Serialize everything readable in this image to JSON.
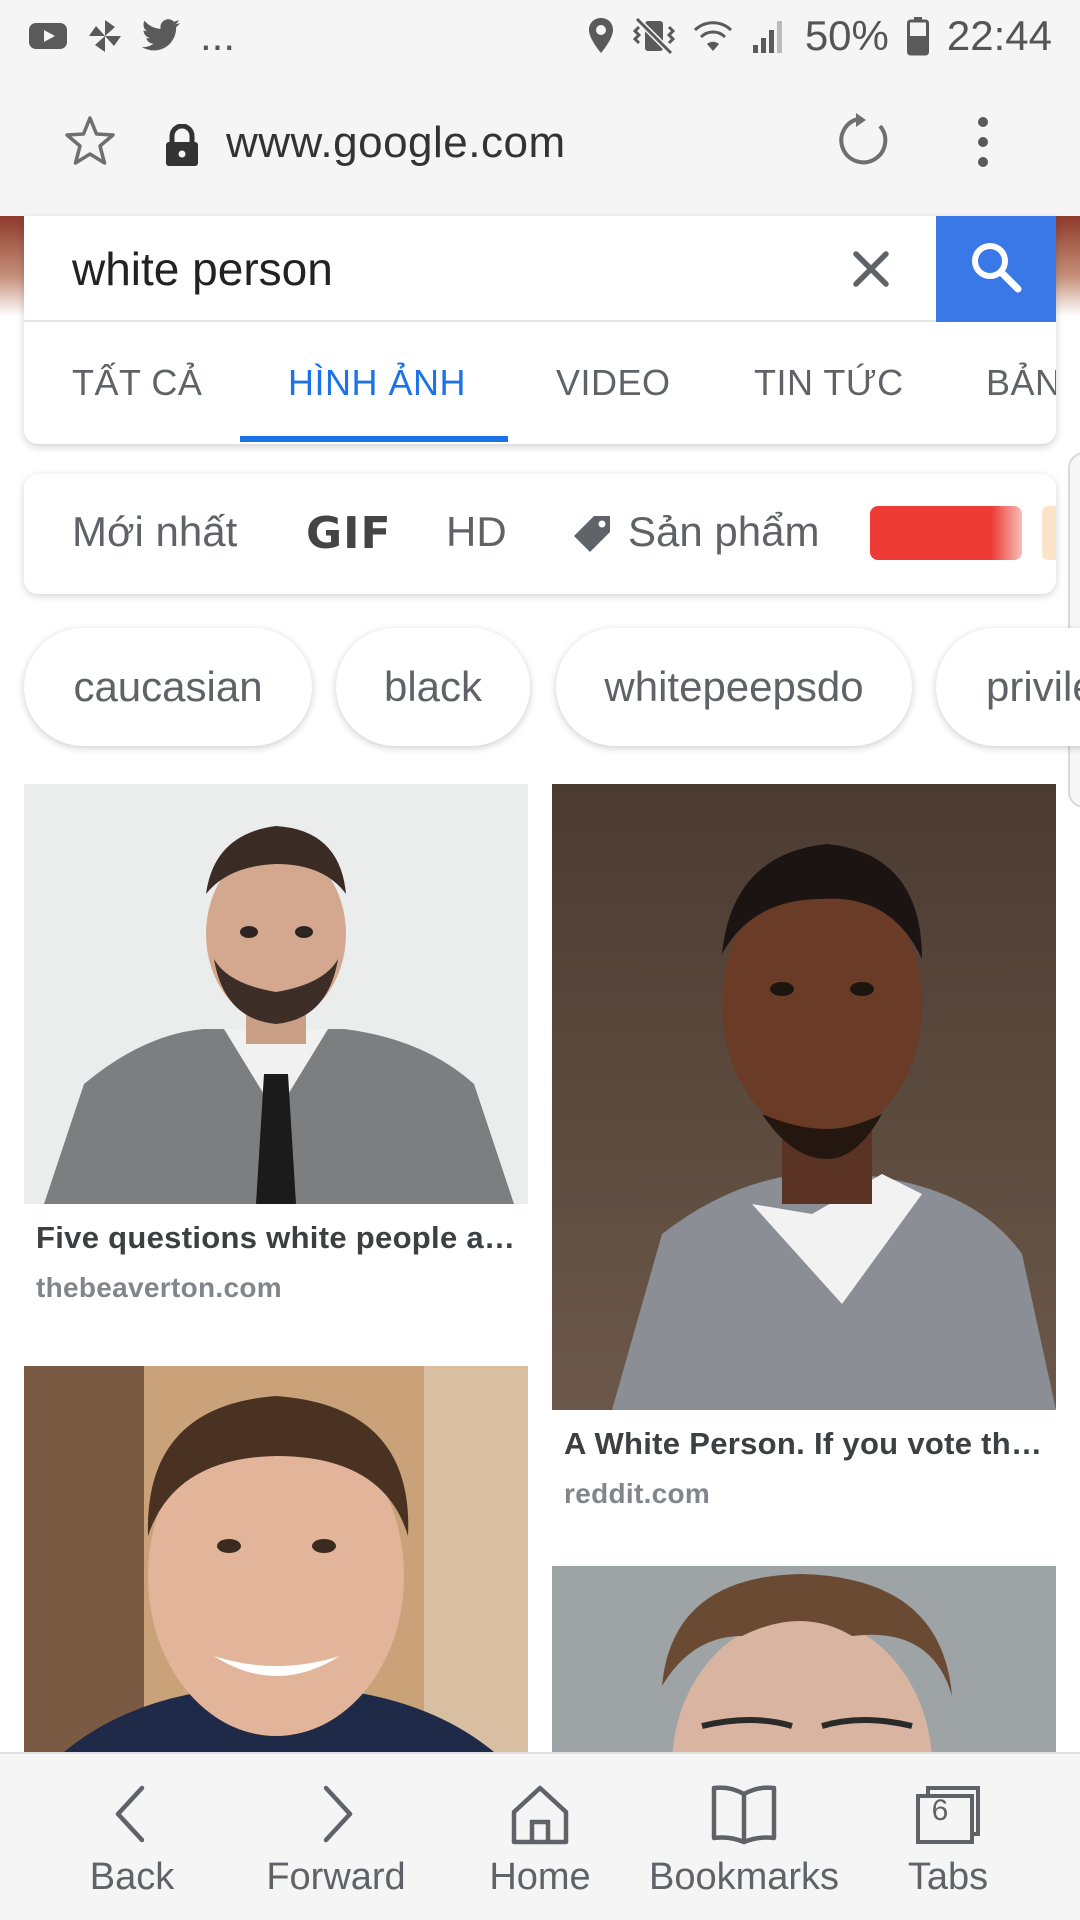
{
  "status_bar": {
    "ellipsis": "...",
    "battery": "50%",
    "time": "22:44",
    "icons": [
      "youtube-icon",
      "pinwheel-icon",
      "twitter-icon",
      "location-icon",
      "vibrate-icon",
      "wifi-icon",
      "signal-icon",
      "battery-icon"
    ]
  },
  "browser": {
    "url": "www.google.com"
  },
  "search": {
    "query": "white person",
    "tabs": [
      {
        "label": "TẤT CẢ",
        "active": false
      },
      {
        "label": "HÌNH ẢNH",
        "active": true
      },
      {
        "label": "VIDEO",
        "active": false
      },
      {
        "label": "TIN TỨC",
        "active": false
      },
      {
        "label": "BẢN",
        "active": false
      }
    ]
  },
  "filters": {
    "newest": "Mới nhất",
    "gif": "GIF",
    "hd": "HD",
    "products": "Sản phẩm",
    "color_swatch": "#ee3b36"
  },
  "chips": [
    "caucasian",
    "black",
    "whitepeepsdo",
    "privile"
  ],
  "results": [
    {
      "title": "Five questions white people a…",
      "domain": "thebeaverton.com"
    },
    {
      "title": "A White Person. If you vote th…",
      "domain": "reddit.com"
    }
  ],
  "bottom_nav": {
    "back": "Back",
    "forward": "Forward",
    "home": "Home",
    "bookmarks": "Bookmarks",
    "tabs": "Tabs",
    "tab_count": "6"
  },
  "colors": {
    "accent": "#1a73e8",
    "search_button": "#3b78e7"
  }
}
